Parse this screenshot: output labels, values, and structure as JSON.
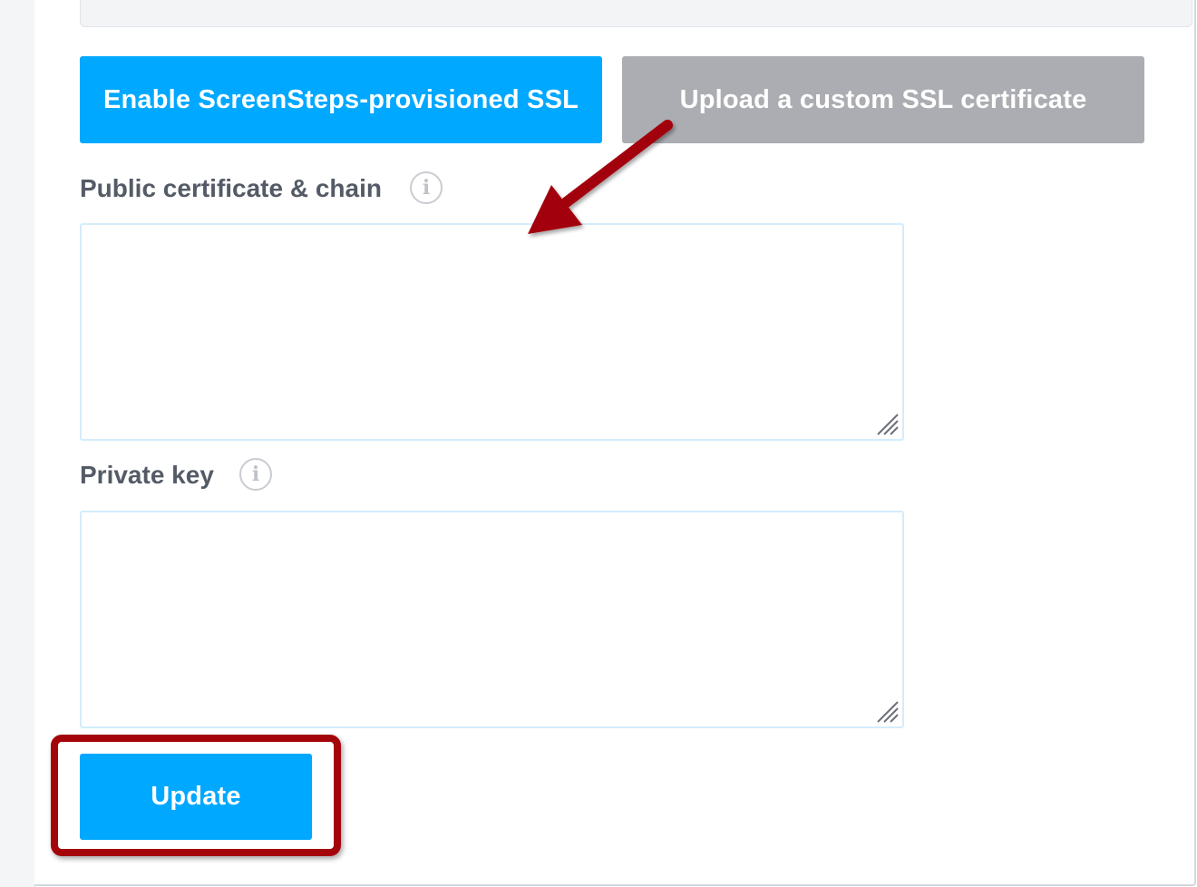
{
  "buttons": {
    "ssl_provisioned": "Enable ScreenSteps-provisioned SSL",
    "upload_custom": "Upload a custom SSL certificate",
    "update": "Update"
  },
  "fields": {
    "public_cert": {
      "label": "Public certificate & chain",
      "value": ""
    },
    "private_key": {
      "label": "Private key",
      "value": ""
    }
  },
  "icons": {
    "info_glyph": "i"
  },
  "colors": {
    "primary": "#00a8ff",
    "inactive": "#acadb2",
    "annotation": "#a3050b",
    "label": "#545b66"
  }
}
